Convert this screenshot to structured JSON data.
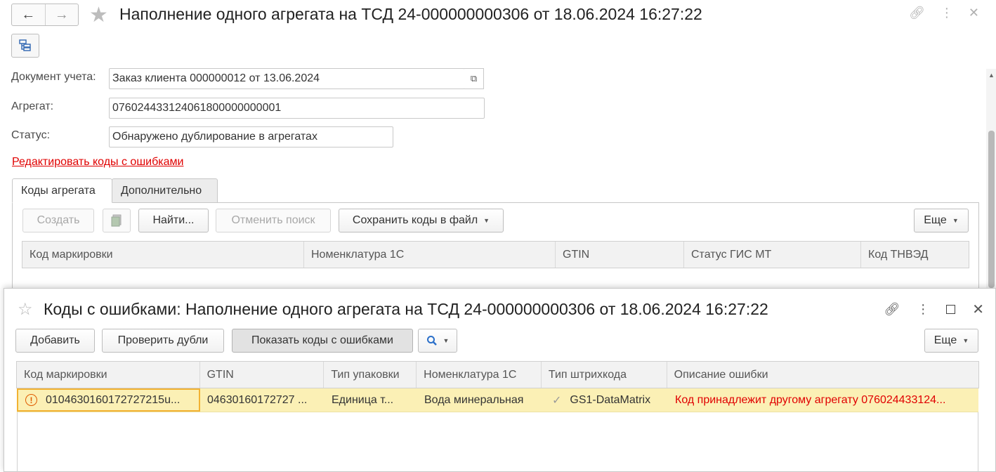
{
  "main": {
    "title": "Наполнение одного агрегата на ТСД 24-000000000306 от 18.06.2024 16:27:22",
    "fields": {
      "doc_label": "Документ учета:",
      "doc_value": "Заказ клиента 000000012 от 13.06.2024",
      "agg_label": "Агрегат:",
      "agg_value": "076024433124061800000000001",
      "status_label": "Статус:",
      "status_value": "Обнаружено дублирование в агрегатах"
    },
    "edit_link": "Редактировать коды с ошибками",
    "tabs": [
      {
        "label": "Коды агрегата",
        "active": true
      },
      {
        "label": "Дополнительно",
        "active": false
      }
    ],
    "toolbar": {
      "create": "Создать",
      "find": "Найти...",
      "cancel_search": "Отменить поиск",
      "save_codes": "Сохранить коды в файл",
      "more": "Еще"
    },
    "columns": [
      "Код маркировки",
      "Номенклатура 1С",
      "GTIN",
      "Статус ГИС МТ",
      "Код ТНВЭД"
    ]
  },
  "popup": {
    "title": "Коды с ошибками: Наполнение одного агрегата на ТСД 24-000000000306 от 18.06.2024 16:27:22",
    "toolbar": {
      "add": "Добавить",
      "check_duplicates": "Проверить дубли",
      "show_error_codes": "Показать коды с ошибками",
      "more": "Еще"
    },
    "columns": [
      "Код маркировки",
      "GTIN",
      "Тип упаковки",
      "Номенклатура 1С",
      "Тип штрихкода",
      "Описание ошибки"
    ],
    "rows": [
      {
        "code": "0104630160172727215u...",
        "gtin": "04630160172727 ...",
        "package": "Единица т...",
        "nomenclature": "Вода минеральная",
        "barcode_type": "GS1-DataMatrix",
        "error": "Код принадлежит другому агрегату 076024433124..."
      }
    ]
  },
  "icons": {
    "back": "arrow-left-icon",
    "forward": "arrow-right-icon",
    "favorite": "star-icon",
    "link": "link-icon",
    "more": "vertical-dots-icon",
    "close": "close-icon",
    "maximize": "maximize-icon",
    "search": "search-icon",
    "warning": "warning-circle-icon",
    "check": "checkmark-icon"
  },
  "colors": {
    "error_text": "#e00000",
    "selected_row": "#fbf0b5",
    "selection_border": "#f2b233"
  }
}
